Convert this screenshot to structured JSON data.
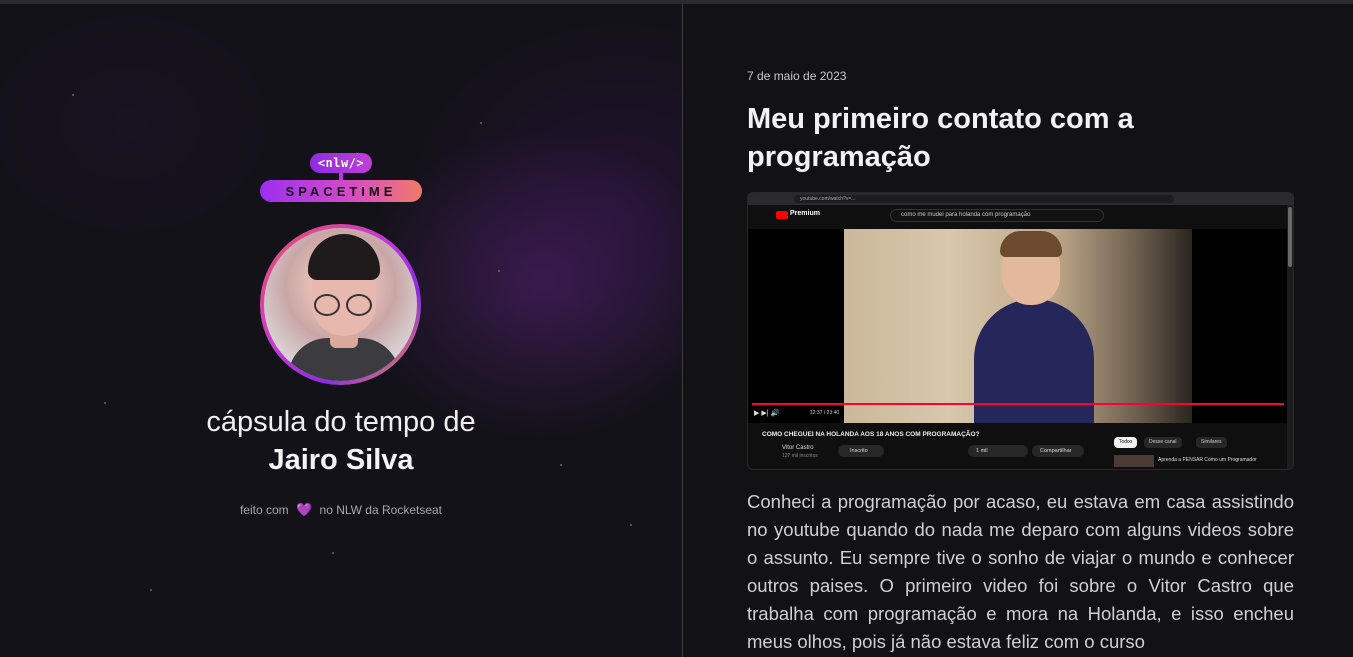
{
  "logo": {
    "top_text": "<nlw/>",
    "bottom_text": "SPACETIME"
  },
  "profile": {
    "capsule_prefix": "cápsula do tempo de",
    "name": "Jairo Silva"
  },
  "footer": {
    "prefix": "feito com",
    "heart_icon": "heart-icon",
    "heart_glyph": "💜",
    "suffix": "no NLW da Rocketseat"
  },
  "colors": {
    "accent_purple": "#9b2ff0",
    "accent_pink": "#d44bc8",
    "accent_orange": "#f07a6a",
    "background": "#121215"
  },
  "memory": {
    "date": "7 de maio de 2023",
    "title": "Meu primeiro contato com a programação",
    "media": {
      "browser_url": "youtube.com/watch?v=...",
      "yt_brand": "Premium",
      "search_query": "como me mudei para holanda com programação",
      "video_time": "12:37 / 23:40",
      "video_title": "COMO CHEGUEI NA HOLANDA AOS 18 ANOS COM PROGRAMAÇÃO?",
      "channel_name": "Vitor Castro",
      "channel_subs": "127 mil inscritos",
      "subscribe_label": "Inscrito",
      "like_label": "1 mil",
      "share_label": "Compartilhar",
      "chips": [
        "Todos",
        "Desse canal",
        "Similares"
      ],
      "side_video_title": "Aprenda a PENSAR Como um Programador"
    },
    "body": "Conheci a programação por acaso, eu estava em casa assistindo no youtube quando do nada me deparo com alguns videos sobre o assunto. Eu sempre tive o sonho de viajar o mundo e conhecer outros paises. O primeiro video foi sobre o Vitor Castro que trabalha com programação e mora na Holanda, e isso encheu meus olhos, pois já não estava feliz com o curso"
  }
}
